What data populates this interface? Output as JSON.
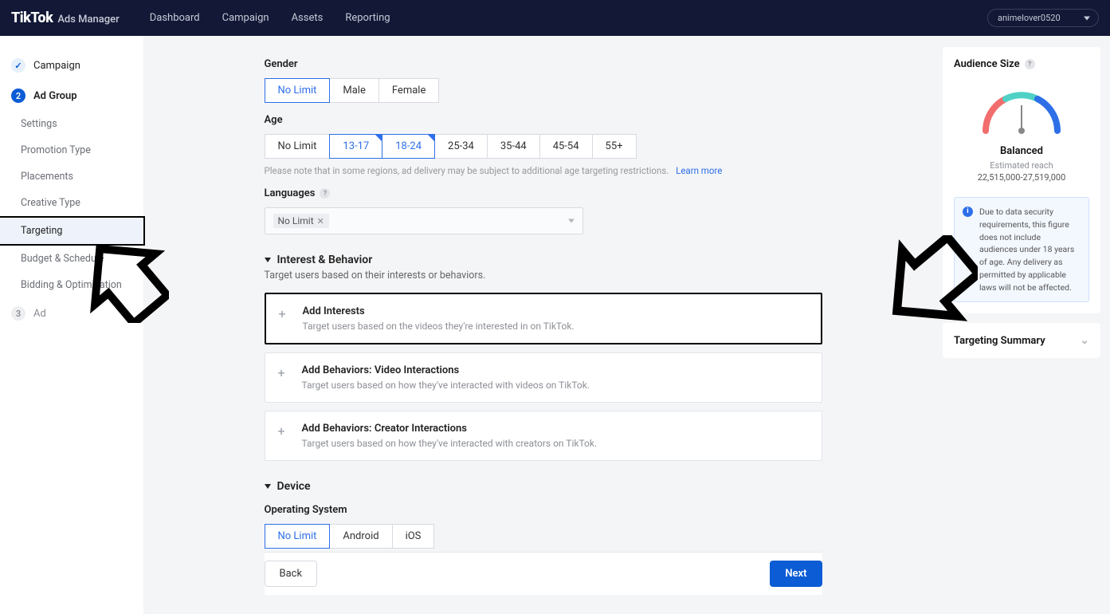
{
  "header": {
    "brand": "TikTok",
    "brand_sub": "Ads Manager",
    "nav": [
      "Dashboard",
      "Campaign",
      "Assets",
      "Reporting"
    ],
    "account": "animelover0520"
  },
  "sidebar": {
    "campaign": "Campaign",
    "adgroup": "Ad Group",
    "adgroup_num": "2",
    "subs": [
      "Settings",
      "Promotion Type",
      "Placements",
      "Creative Type",
      "Targeting",
      "Budget & Schedule",
      "Bidding & Optimization"
    ],
    "ad": "Ad",
    "ad_num": "3"
  },
  "form": {
    "gender": {
      "label": "Gender",
      "options": [
        "No Limit",
        "Male",
        "Female"
      ]
    },
    "age": {
      "label": "Age",
      "options": [
        "No Limit",
        "13-17",
        "18-24",
        "25-34",
        "35-44",
        "45-54",
        "55+"
      ],
      "hint": "Please note that in some regions, ad delivery may be subject to additional age targeting restrictions.",
      "hint_link": "Learn more"
    },
    "languages": {
      "label": "Languages",
      "chip": "No Limit"
    },
    "interest": {
      "title": "Interest & Behavior",
      "sub": "Target users based on their interests or behaviors.",
      "cards": [
        {
          "title": "Add Interests",
          "desc": "Target users based on the videos they're interested in on TikTok."
        },
        {
          "title": "Add Behaviors: Video Interactions",
          "desc": "Target users based on how they've interacted with videos on TikTok."
        },
        {
          "title": "Add Behaviors: Creator Interactions",
          "desc": "Target users based on how they've interacted with creators on TikTok."
        }
      ]
    },
    "device": {
      "title": "Device",
      "os_label": "Operating System",
      "os_options": [
        "No Limit",
        "Android",
        "iOS"
      ]
    },
    "footer": {
      "back": "Back",
      "next": "Next"
    }
  },
  "right": {
    "audience": {
      "title": "Audience Size",
      "status": "Balanced",
      "reach_label": "Estimated reach",
      "reach": "22,515,000-27,519,000",
      "info": "Due to data security requirements, this figure does not include audiences under 18 years of age. Any delivery as permitted by applicable laws will not be affected."
    },
    "summary": "Targeting Summary"
  }
}
